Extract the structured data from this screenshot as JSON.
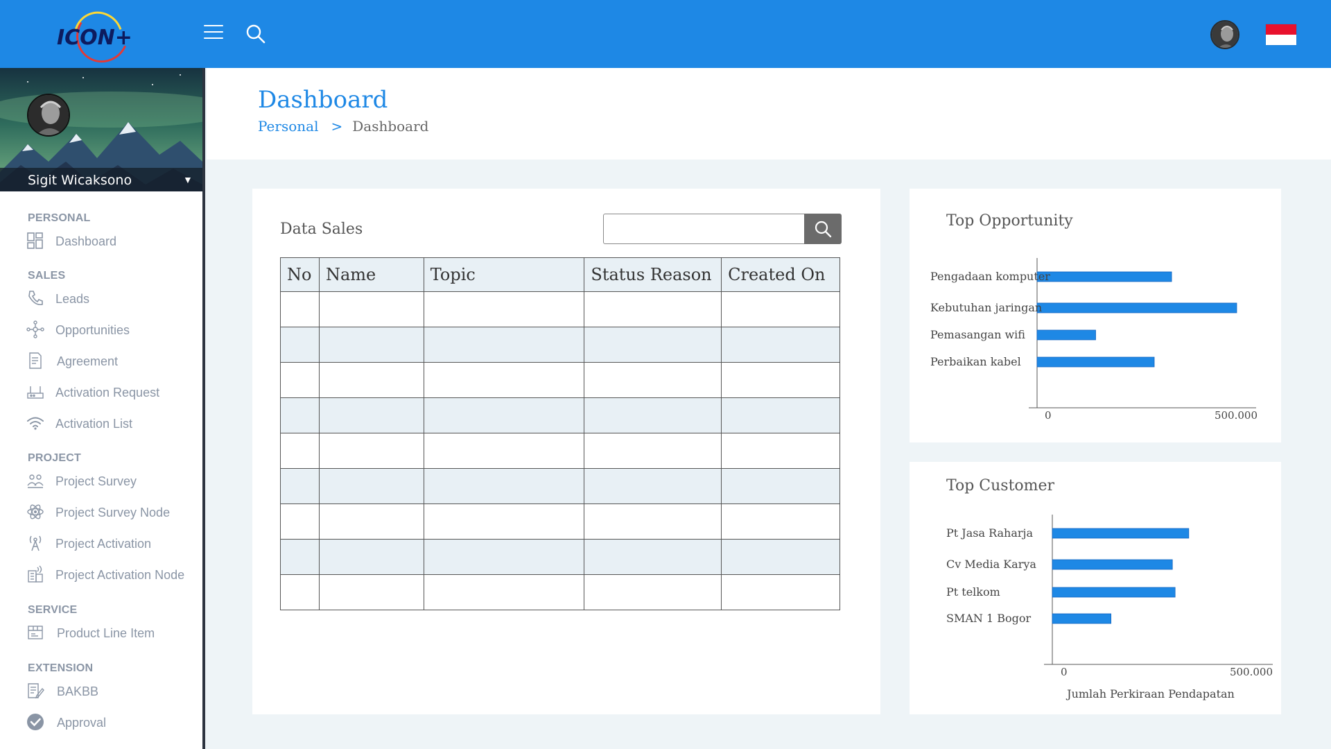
{
  "topbar": {
    "logo_text": "ICON+",
    "menu_icon": "hamburger-icon",
    "search_icon": "search-icon",
    "language_flag": "indonesia-flag"
  },
  "sidebar": {
    "user_name": "Sigit Wicaksono",
    "sections": [
      {
        "title": "PERSONAL",
        "items": [
          {
            "label": "Dashboard",
            "icon": "dashboard-icon"
          }
        ]
      },
      {
        "title": "SALES",
        "items": [
          {
            "label": "Leads",
            "icon": "phone-icon"
          },
          {
            "label": "Opportunities",
            "icon": "network-icon"
          },
          {
            "label": "Agreement",
            "icon": "document-icon"
          },
          {
            "label": "Activation Request",
            "icon": "router-icon"
          },
          {
            "label": "Activation List",
            "icon": "wifi-icon"
          }
        ]
      },
      {
        "title": "PROJECT",
        "items": [
          {
            "label": "Project Survey",
            "icon": "survey-icon"
          },
          {
            "label": "Project Survey Node",
            "icon": "atom-icon"
          },
          {
            "label": "Project Activation",
            "icon": "antenna-icon"
          },
          {
            "label": "Project Activation Node",
            "icon": "building-icon"
          }
        ]
      },
      {
        "title": "SERVICE",
        "items": [
          {
            "label": "Product Line Item",
            "icon": "box-icon"
          }
        ]
      },
      {
        "title": "EXTENSION",
        "items": [
          {
            "label": "BAKBB",
            "icon": "edit-document-icon"
          },
          {
            "label": "Approval",
            "icon": "check-circle-icon"
          }
        ]
      }
    ]
  },
  "header": {
    "title": "Dashboard",
    "breadcrumb": {
      "parent": "Personal",
      "separator": ">",
      "current": "Dashboard"
    }
  },
  "sales": {
    "title": "Data Sales",
    "search_placeholder": "",
    "columns": [
      "No",
      "Name",
      "Topic",
      "Status Reason",
      "Created On"
    ],
    "rows": [
      [
        "",
        "",
        "",
        "",
        ""
      ],
      [
        "",
        "",
        "",
        "",
        ""
      ],
      [
        "",
        "",
        "",
        "",
        ""
      ],
      [
        "",
        "",
        "",
        "",
        ""
      ],
      [
        "",
        "",
        "",
        "",
        ""
      ],
      [
        "",
        "",
        "",
        "",
        ""
      ],
      [
        "",
        "",
        "",
        "",
        ""
      ],
      [
        "",
        "",
        "",
        "",
        ""
      ],
      [
        "",
        "",
        "",
        "",
        ""
      ]
    ]
  },
  "colors": {
    "primary": "#1e88e5",
    "sidebar_text": "#8a95a5",
    "background": "#eef4f7"
  },
  "chart_data": [
    {
      "type": "bar",
      "orientation": "horizontal",
      "title": "Top Opportunity",
      "categories": [
        "Pengadaan komputer",
        "Kebutuhan jaringan",
        "Pemasangan wifi",
        "Perbaikan kabel"
      ],
      "values": [
        310000,
        460000,
        135000,
        270000
      ],
      "xlim": [
        0,
        500000
      ],
      "x_ticks": [
        "0",
        "500.000"
      ],
      "xlabel": "",
      "color": "#1e88e5"
    },
    {
      "type": "bar",
      "orientation": "horizontal",
      "title": "Top Customer",
      "categories": [
        "Pt Jasa Raharja",
        "Cv Media Karya",
        "Pt telkom",
        "SMAN 1 Bogor"
      ],
      "values": [
        400000,
        352000,
        360000,
        172000
      ],
      "xlim": [
        0,
        500000
      ],
      "x_ticks": [
        "0",
        "500.000"
      ],
      "xlabel": "Jumlah Perkiraan Pendapatan",
      "color": "#1e88e5"
    }
  ]
}
